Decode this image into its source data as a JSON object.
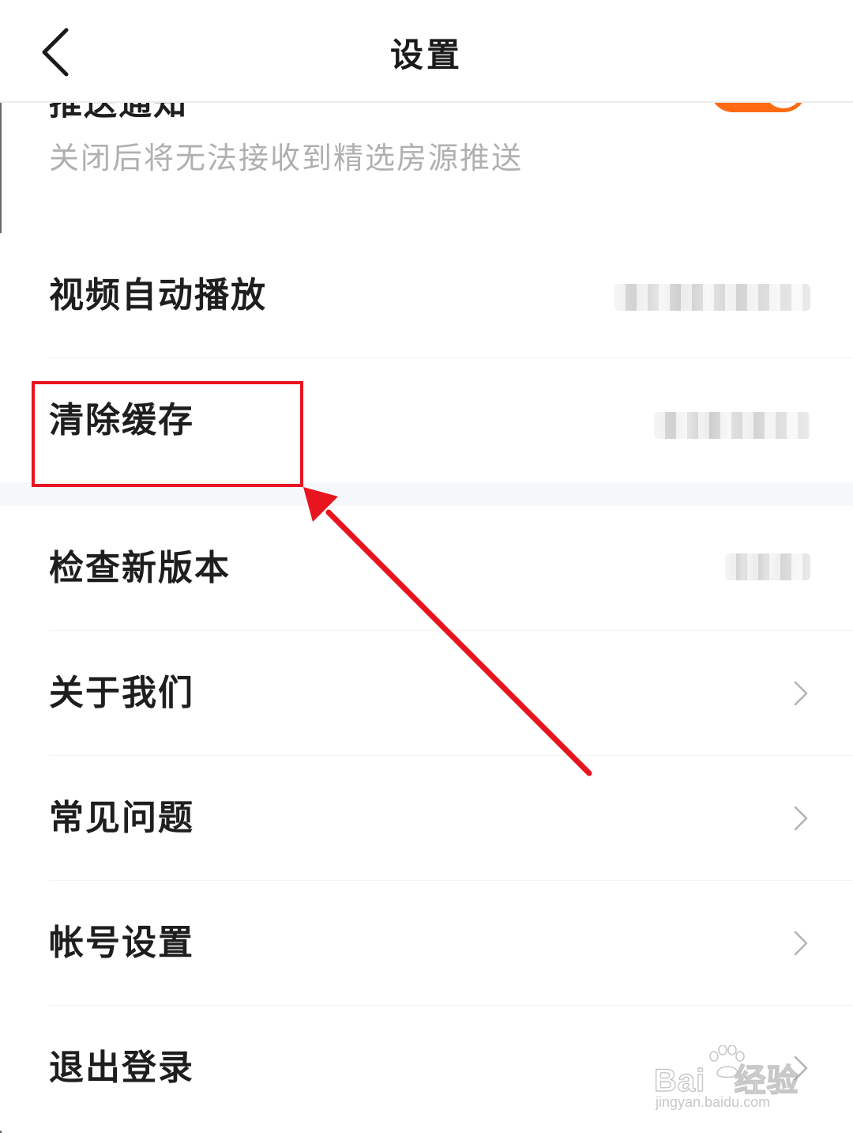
{
  "header": {
    "title": "设置"
  },
  "push_notification": {
    "title": "推送通知",
    "description": "关闭后将无法接收到精选房源推送",
    "enabled": true
  },
  "settings": [
    {
      "label": "视频自动播放"
    },
    {
      "label": "清除缓存"
    },
    {
      "label": "检查新版本"
    },
    {
      "label": "关于我们"
    },
    {
      "label": "常见问题"
    },
    {
      "label": "帐号设置"
    },
    {
      "label": "退出登录"
    }
  ],
  "annotation": {
    "color": "#e8141e",
    "target": "清除缓存"
  },
  "watermark": {
    "logo": "Baidu经验",
    "url": "jingyan.baidu.com"
  },
  "colors": {
    "accent": "#ff6a13",
    "annotation": "#e8141e",
    "section_gap": "#f6f7fb"
  }
}
